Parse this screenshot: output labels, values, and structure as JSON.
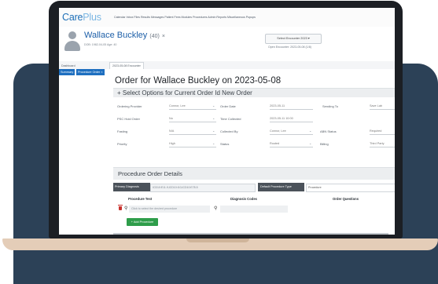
{
  "app": {
    "logo_main": "Care",
    "logo_accent": "Plus",
    "menu": "Calendar  Inbox  Files  Results  Messages  Patient  Fees  Modules  Procedures  Admin  Reports  Miscellaneous  Popups"
  },
  "patient": {
    "name": "Wallace Buckley",
    "age": "(40)",
    "close": "×",
    "subline": "DOB: 1982-04-05  Age: 40",
    "encounter_button": "Select Encounter  2023  ▾",
    "encounter_info": "Open Encounter: 2023-05-08 (1/8)"
  },
  "tabs": {
    "dashboard": "Dashboard",
    "encounter": "2023-05-08 Encounter",
    "summary": "Summary",
    "procedure_order": "Procedure Order ×"
  },
  "order": {
    "title": "Order for Wallace Buckley on 2023-05-08",
    "section_title": "+ Select Options for Current Order Id New Order"
  },
  "form": {
    "rows": [
      {
        "l1": "Ordering Provider",
        "v1": "Connor, Lee",
        "l2": "Order Date",
        "v2": "2023-05-11",
        "l3": "Sending To",
        "v3": "Save Lab"
      },
      {
        "l1": "PSC Hold Order",
        "v1": "No",
        "l2": "Time Collected",
        "v2": "2023-05-11 10:00",
        "l3": "",
        "v3": ""
      },
      {
        "l1": "Fasting",
        "v1": "N/A",
        "l2": "Collected By",
        "v2": "Connor, Lee",
        "l3": "ABN Status",
        "v3": "Required"
      },
      {
        "l1": "Priority",
        "v1": "High",
        "l2": "Status",
        "v2": "Routed",
        "l3": "Billing",
        "v3": "Third Party"
      }
    ]
  },
  "details": {
    "title": "Procedure Order Details",
    "primary_dx_label": "Primary Diagnosis",
    "primary_dx_value": "ICD10:E11.9;ICD10:I10;ICD10:E78.5",
    "default_type_label": "Default Procedure Type",
    "default_type_value": "Procedure"
  },
  "procedure_table": {
    "col_procedure": "Procedure Test",
    "col_diagnosis": "Diagnosis Codes",
    "col_questions": "Order Questions",
    "row_placeholder": "Click to select the desired procedure",
    "add_button": "+ Add Procedure"
  }
}
